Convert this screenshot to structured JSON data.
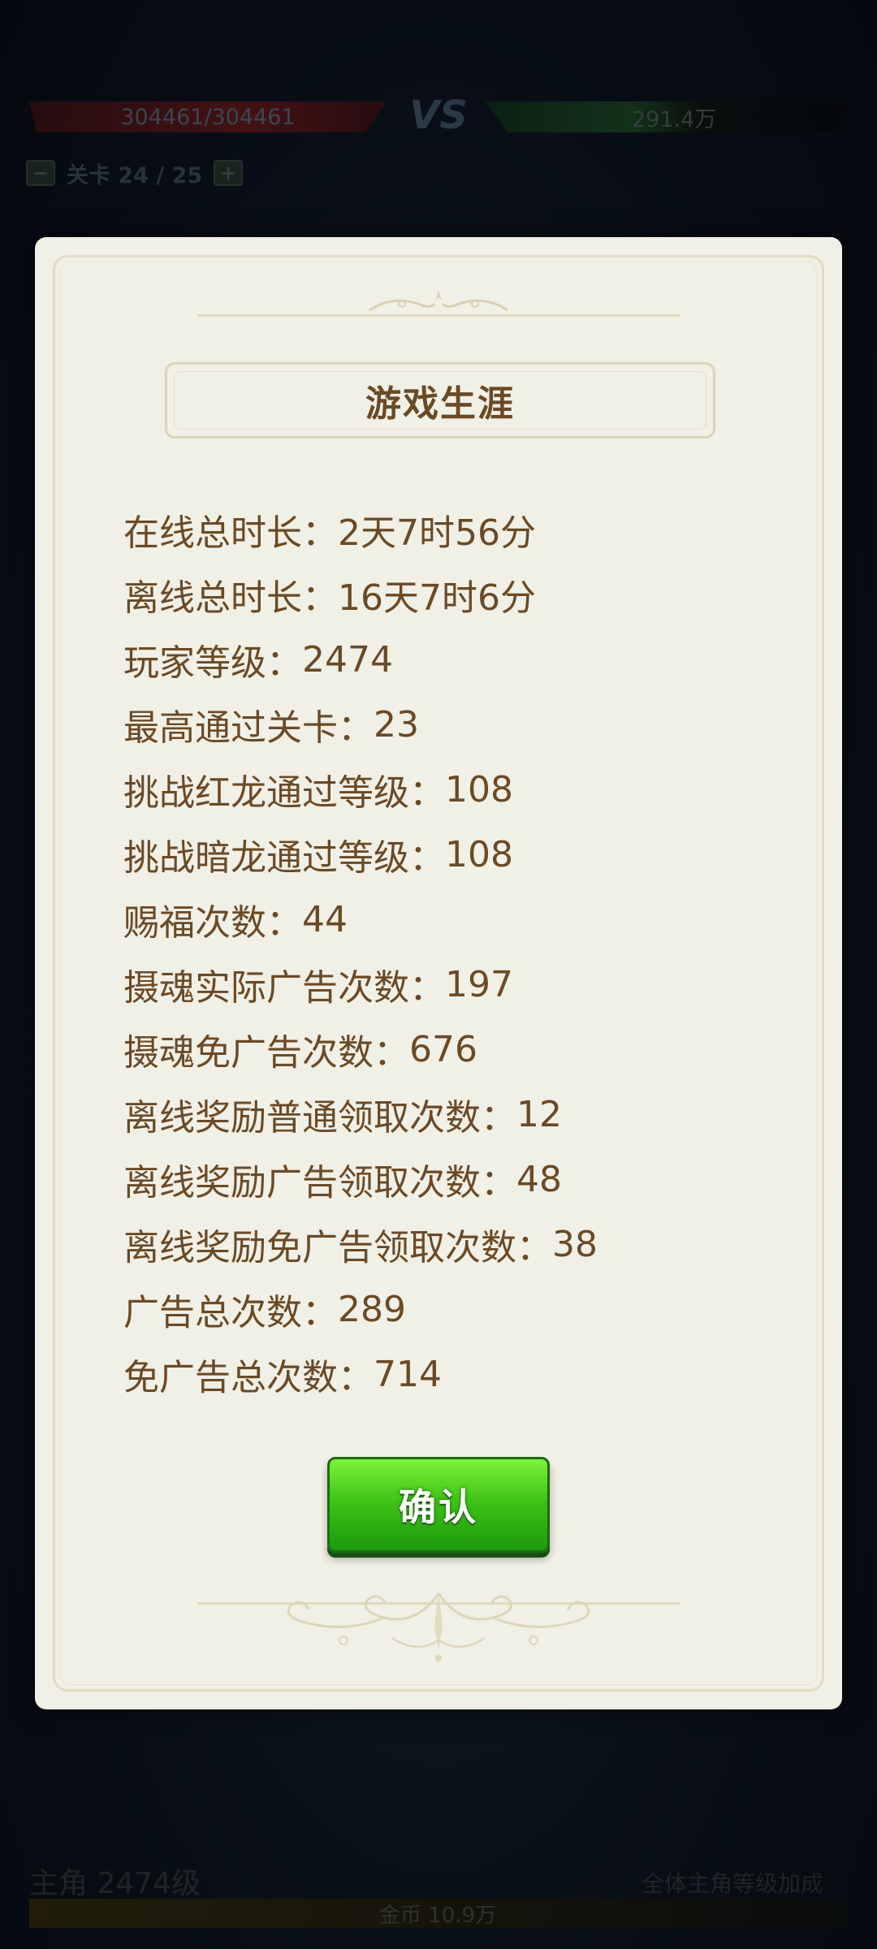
{
  "battle_bar": {
    "player_hp": "304461/304461",
    "vs_label": "VS",
    "enemy_hp": "291.4万",
    "stage_label": "关卡 24 / 25",
    "stage_prev": "−",
    "stage_next": "+"
  },
  "dialog": {
    "title": "游戏生涯",
    "stats": [
      {
        "label": "在线总时长：",
        "value": "2天7时56分"
      },
      {
        "label": "离线总时长：",
        "value": "16天7时6分"
      },
      {
        "label": "玩家等级：",
        "value": "2474"
      },
      {
        "label": "最高通过关卡：",
        "value": "23"
      },
      {
        "label": "挑战红龙通过等级：",
        "value": "108"
      },
      {
        "label": "挑战暗龙通过等级：",
        "value": "108"
      },
      {
        "label": "赐福次数：",
        "value": "44"
      },
      {
        "label": "摄魂实际广告次数：",
        "value": "197"
      },
      {
        "label": "摄魂免广告次数：",
        "value": "676"
      },
      {
        "label": "离线奖励普通领取次数：",
        "value": "12"
      },
      {
        "label": "离线奖励广告领取次数：",
        "value": "48"
      },
      {
        "label": "离线奖励免广告领取次数：",
        "value": "38"
      },
      {
        "label": "广告总次数：",
        "value": "289"
      },
      {
        "label": "免广告总次数：",
        "value": "714"
      }
    ],
    "confirm_label": "确认"
  },
  "hero_bar": {
    "name": "主角 2474级",
    "right_text": "全体主角等级加成",
    "exp_text": "金币 10.9万"
  },
  "colors": {
    "panel_bg": "#f1f0e6",
    "text_brown": "#6a4a26",
    "button_green": "#3fc417"
  }
}
